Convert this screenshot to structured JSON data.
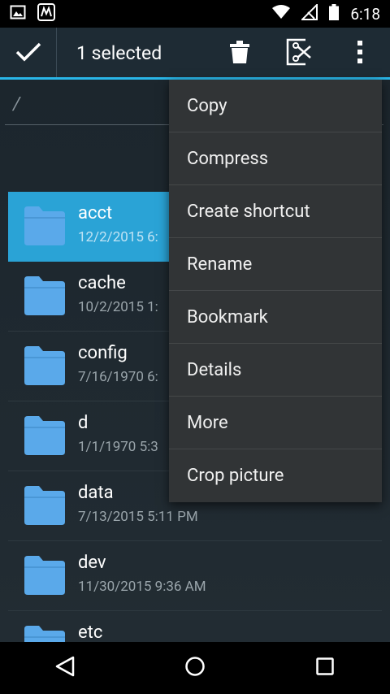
{
  "status_bar": {
    "time": "6:18"
  },
  "app_bar": {
    "selection_label": "1 selected",
    "actions": [
      "check-icon",
      "trash-icon",
      "cut-icon",
      "more-vert-icon"
    ]
  },
  "path": {
    "value": "/"
  },
  "files": [
    {
      "name": "acct",
      "date": "12/2/2015 6:",
      "selected": true
    },
    {
      "name": "cache",
      "date": "10/2/2015 1:"
    },
    {
      "name": "config",
      "date": "7/16/1970 6:"
    },
    {
      "name": "d",
      "date": "1/1/1970 5:3"
    },
    {
      "name": "data",
      "date": "7/13/2015 5:11 PM"
    },
    {
      "name": "dev",
      "date": "11/30/2015 9:36 AM"
    },
    {
      "name": "etc",
      "date": ""
    }
  ],
  "menu": {
    "items": [
      "Copy",
      "Compress",
      "Create shortcut",
      "Rename",
      "Bookmark",
      "Details",
      "More",
      "Crop picture"
    ]
  },
  "colors": {
    "accent": "#29b6e8",
    "selected_row": "#2aa3d6",
    "folder": "#5aa9ea",
    "app_bar": "#1e2b34"
  }
}
